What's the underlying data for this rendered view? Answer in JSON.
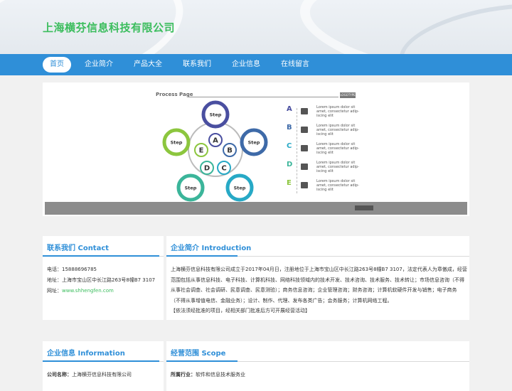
{
  "header": {
    "site_title": "上海横芬信息科技有限公司"
  },
  "nav": {
    "items": [
      "首页",
      "企业简介",
      "产品大全",
      "联系我们",
      "企业信息",
      "在线留言"
    ],
    "active_index": 0
  },
  "banner": {
    "process_title": "Process Page",
    "logotype": "LOGOTYPE",
    "center_letters": [
      "A",
      "B",
      "C",
      "D",
      "E"
    ],
    "step_label": "Step",
    "side_letters": [
      "A",
      "B",
      "C",
      "D",
      "E"
    ],
    "side_text": "Lorem ipsum dolor sit amet, consectetur adip-iscing elit",
    "colors": [
      "#4a4fa0",
      "#3e6aa8",
      "#27a9c6",
      "#3bb59a",
      "#8cc63e"
    ]
  },
  "contact": {
    "title": "联系我们 Contact",
    "phone": "电话：15888696785",
    "address": "地址：上海市宝山区中长江路263号8幢B7 3107",
    "website_label": "网址：",
    "website": "www.shhengfen.com"
  },
  "intro": {
    "title": "企业简介 Introduction",
    "lines": [
      "上海横芬信息科技有限公司成立于2017年04月日，注册地位于上海市宝山区中长江路263号8幢B7 3107，法定代表人为章傲成，经营",
      "范围包括从事信息科技、电子科技、计算机科技、网络科技领域内的技术开发、技术咨询、技术服务、技术转让；市场信息咨询（不得",
      "从事社会调查、社会调研、民意调查、民意测验）；商务信息咨询；企业管理咨询；财务咨询；计算机软硬件开发与销售；电子商务",
      "（不得从事增值电信、金融业务）；设计、制作、代理、发布各类广告；会务服务；计算机网络工程。",
      "【依法须经批准的项目，经相关部门批准后方可开展经营活动】"
    ]
  },
  "info": {
    "title": "企业信息 Information",
    "company_label": "公司名称：",
    "company_value": "上海横芬信息科技有限公司"
  },
  "scope": {
    "title": "经营范围 Scope",
    "industry_label": "所属行业：",
    "industry_value": "软件和信息技术服务业"
  }
}
